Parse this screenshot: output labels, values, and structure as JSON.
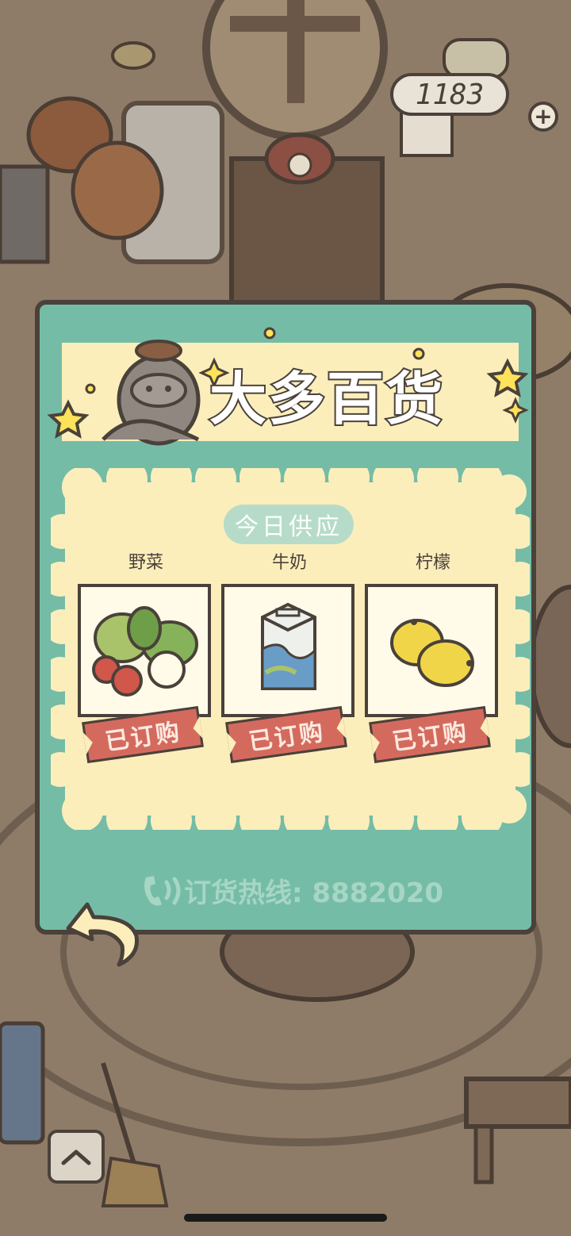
{
  "hud": {
    "currency_value": "1183",
    "add_symbol": "+"
  },
  "shop": {
    "title": "大多百货",
    "section_label": "今日供应",
    "items": [
      {
        "name": "野菜",
        "status": "已订购",
        "icon": "vegetables-icon"
      },
      {
        "name": "牛奶",
        "status": "已订购",
        "icon": "milk-carton-icon"
      },
      {
        "name": "柠檬",
        "status": "已订购",
        "icon": "lemon-icon"
      }
    ],
    "hotline": "订货热线: 8882020"
  },
  "colors": {
    "panel": "#75bca7",
    "banner": "#fbeebb",
    "ordered_tag": "#d46a5e",
    "outline": "#4a413a"
  }
}
